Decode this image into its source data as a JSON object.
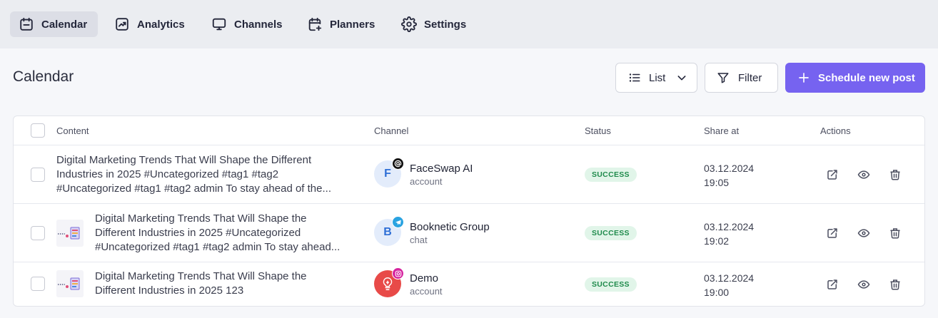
{
  "nav": {
    "items": [
      {
        "label": "Calendar",
        "icon": "calendar-icon",
        "active": true
      },
      {
        "label": "Analytics",
        "icon": "analytics-icon"
      },
      {
        "label": "Channels",
        "icon": "monitor-icon"
      },
      {
        "label": "Planners",
        "icon": "calendar-plus-icon"
      },
      {
        "label": "Settings",
        "icon": "gear-icon"
      }
    ]
  },
  "header": {
    "title": "Calendar",
    "view_label": "List",
    "filter_label": "Filter",
    "schedule_label": "Schedule new post"
  },
  "table": {
    "columns": [
      "Content",
      "Channel",
      "Status",
      "Share at",
      "Actions"
    ],
    "rows": [
      {
        "content_lines": [
          "Digital Marketing Trends That Will Shape the Different",
          "Industries in 2025 #Uncategorized #tag1 #tag2",
          "#Uncategorized #tag1 #tag2 admin To stay ahead of the..."
        ],
        "has_thumb": false,
        "channel": {
          "initial": "F",
          "name": "FaceSwap AI",
          "type": "account",
          "platform_icon": "threads-icon"
        },
        "status": "SUCCESS",
        "date": "03.12.2024",
        "time": "19:05"
      },
      {
        "content_lines": [
          "Digital Marketing Trends That Will Shape the",
          "Different Industries in 2025 #Uncategorized",
          "#Uncategorized #tag1 #tag2 admin To stay ahead..."
        ],
        "has_thumb": true,
        "channel": {
          "initial": "B",
          "name": "Booknetic Group",
          "type": "chat",
          "platform_icon": "telegram-icon"
        },
        "status": "SUCCESS",
        "date": "03.12.2024",
        "time": "19:02"
      },
      {
        "content_lines": [
          "Digital Marketing Trends That Will Shape the",
          "Different Industries in 2025 123"
        ],
        "has_thumb": true,
        "channel": {
          "initial": "",
          "name": "Demo",
          "type": "account",
          "platform_icon": "instagram-icon"
        },
        "status": "SUCCESS",
        "date": "03.12.2024",
        "time": "19:00"
      }
    ]
  },
  "colors": {
    "accent": "#7663f0",
    "success_bg": "#e1f5e9",
    "success_text": "#1e8a4b",
    "nav_bg": "#ebedf1"
  }
}
